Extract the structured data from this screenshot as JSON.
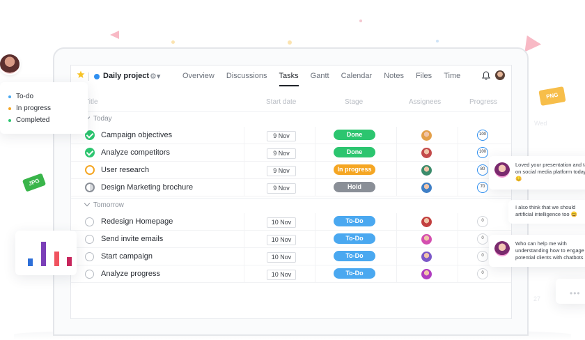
{
  "project": {
    "name": "Daily project"
  },
  "nav": {
    "tabs": [
      "Overview",
      "Discussions",
      "Tasks",
      "Gantt",
      "Calendar",
      "Notes",
      "Files",
      "Time"
    ],
    "active": "Tasks"
  },
  "table": {
    "headers": {
      "title": "Title",
      "start_date": "Start date",
      "stage": "Stage",
      "assignees": "Assignees",
      "progress": "Progress"
    },
    "sections": [
      {
        "label": "Today",
        "rows": [
          {
            "status": "done",
            "title": "Campaign objectives",
            "date": "9 Nov",
            "stage": "Done",
            "stage_color": "#2cc56f",
            "progress": "100"
          },
          {
            "status": "done",
            "title": "Analyze competitors",
            "date": "9 Nov",
            "stage": "Done",
            "stage_color": "#2cc56f",
            "progress": "100"
          },
          {
            "status": "inprog",
            "title": "User research",
            "date": "9 Nov",
            "stage": "In progress",
            "stage_color": "#f5a623",
            "progress": "80"
          },
          {
            "status": "hold",
            "title": "Design Marketing brochure",
            "date": "9 Nov",
            "stage": "Hold",
            "stage_color": "#8a8f97",
            "progress": "70"
          }
        ]
      },
      {
        "label": "Tomorrow",
        "rows": [
          {
            "status": "todo",
            "title": "Redesign Homepage",
            "date": "10 Nov",
            "stage": "To-Do",
            "stage_color": "#4aa8f0",
            "progress": "0"
          },
          {
            "status": "todo",
            "title": "Send invite emails",
            "date": "10 Nov",
            "stage": "To-Do",
            "stage_color": "#4aa8f0",
            "progress": "0"
          },
          {
            "status": "todo",
            "title": "Start campaign",
            "date": "10 Nov",
            "stage": "To-Do",
            "stage_color": "#4aa8f0",
            "progress": "0"
          },
          {
            "status": "todo",
            "title": "Analyze progress",
            "date": "10 Nov",
            "stage": "To-Do",
            "stage_color": "#4aa8f0",
            "progress": "0"
          }
        ]
      }
    ]
  },
  "legend": {
    "items": [
      {
        "label": "To-do",
        "color": "#4aa8f0"
      },
      {
        "label": "In progress",
        "color": "#f5a623"
      },
      {
        "label": "Completed",
        "color": "#2cc56f"
      }
    ]
  },
  "badges": {
    "png": "PNG",
    "jpg": "JPG"
  },
  "ghost": {
    "wed": "Wed",
    "num": "27"
  },
  "chats": [
    {
      "text": "Loved your presentation and take on social media platform today! 😊"
    },
    {
      "text": "I also think that we should artificial intelligence too 😄"
    },
    {
      "text": "Who can help me with understanding how to engage potential clients with chatbots"
    }
  ],
  "colors": {
    "accent": "#2f8ff0",
    "done": "#2cc56f",
    "in_progress": "#f5a623",
    "hold": "#8a8f97",
    "todo": "#4aa8f0"
  }
}
